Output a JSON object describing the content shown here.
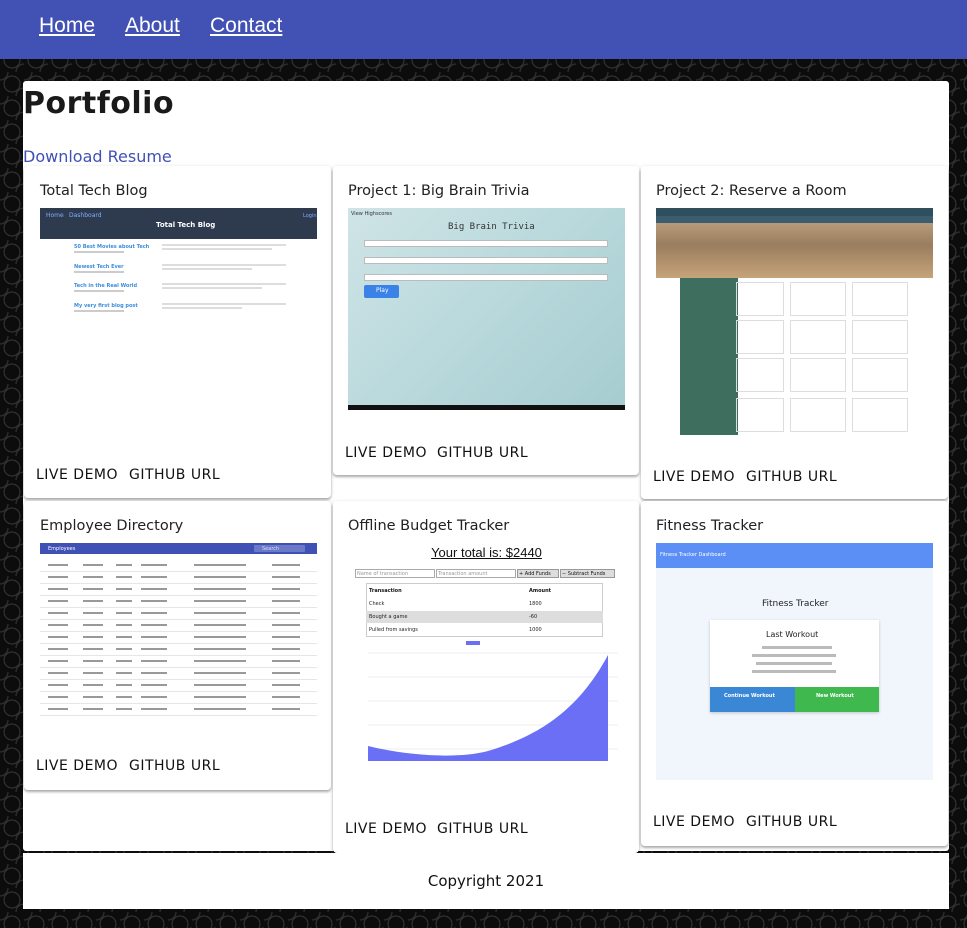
{
  "nav": {
    "links": [
      "Home",
      "About",
      "Contact"
    ],
    "color": "#4252b4"
  },
  "page": {
    "title": "Portfolio",
    "resume_link": "Download Resume"
  },
  "cards": [
    {
      "title": "Total Tech Blog",
      "live_demo": "LIVE DEMO",
      "github": "GITHUB URL",
      "thumb": {
        "nav_home": "Home",
        "nav_dashboard": "Dashboard",
        "nav_login": "Login",
        "header": "Total Tech Blog",
        "posts": [
          "50 Best Movies about Tech",
          "Newest Tech Ever",
          "Tech in the Real World",
          "My very first blog post"
        ]
      }
    },
    {
      "title": "Project 1: Big Brain Trivia",
      "live_demo": "LIVE DEMO",
      "github": "GITHUB URL",
      "thumb": {
        "top_label": "View Highscores",
        "header": "Big Brain Trivia",
        "play": "Play"
      }
    },
    {
      "title": "Project 2: Reserve a Room",
      "live_demo": "LIVE DEMO",
      "github": "GITHUB URL",
      "thumb": {}
    },
    {
      "title": "Employee Directory",
      "live_demo": "LIVE DEMO",
      "github": "GITHUB URL",
      "thumb": {
        "header": "Employees",
        "search": "Search"
      }
    },
    {
      "title": "Offline Budget Tracker",
      "live_demo": "LIVE DEMO",
      "github": "GITHUB URL",
      "thumb": {
        "total": "Your total is: $2440",
        "name_placeholder": "Name of transaction",
        "amount_placeholder": "Transaction amount",
        "add": "+ Add Funds",
        "subtract": "− Subtract Funds",
        "columns": [
          "Transaction",
          "Amount"
        ],
        "rows": [
          [
            "Check",
            "1800"
          ],
          [
            "Bought a game",
            "-60"
          ],
          [
            "Pulled from savings",
            "1000"
          ]
        ]
      }
    },
    {
      "title": "Fitness Tracker",
      "live_demo": "LIVE DEMO",
      "github": "GITHUB URL",
      "thumb": {
        "topbar": "Fitness Tracker Dashboard",
        "header": "Fitness Tracker",
        "box_title": "Last Workout",
        "continue": "Continue Workout",
        "new": "New Workout"
      }
    }
  ],
  "footer": {
    "text": "Copyright 2021"
  }
}
